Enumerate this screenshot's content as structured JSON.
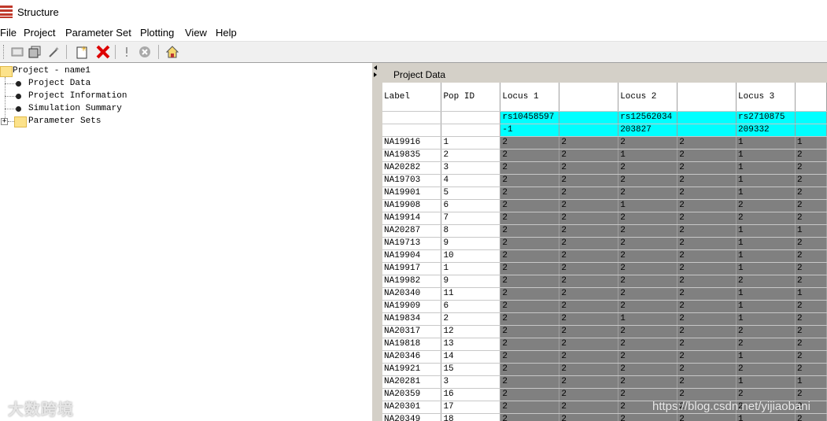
{
  "window": {
    "title": "Structure"
  },
  "menu": [
    "File",
    "Project",
    "Parameter Set",
    "Plotting",
    "View",
    "Help"
  ],
  "toolbar": {
    "icons": [
      "open-project-icon",
      "save-project-icon",
      "wizard-icon",
      "new-param-set-icon",
      "delete-icon",
      "warning-icon",
      "stop-icon",
      "home-icon"
    ]
  },
  "tree": {
    "root": "Project - name1",
    "children": [
      "Project Data",
      "Project Information",
      "Simulation Summary"
    ],
    "folder": "Parameter Sets"
  },
  "panel": {
    "title": "Project Data"
  },
  "grid": {
    "headers": [
      "Label",
      "Pop ID",
      "Locus 1",
      "",
      "Locus 2",
      "",
      "Locus 3",
      ""
    ],
    "snp_row": [
      "",
      "",
      "rs10458597",
      "",
      "rs12562034",
      "",
      "rs2710875",
      ""
    ],
    "pos_row": [
      "",
      "",
      "-1",
      "",
      "203827",
      "",
      "209332",
      ""
    ],
    "rows": [
      [
        "NA19916",
        "1",
        "2",
        "2",
        "2",
        "2",
        "1",
        "1"
      ],
      [
        "NA19835",
        "2",
        "2",
        "2",
        "1",
        "2",
        "1",
        "2"
      ],
      [
        "NA20282",
        "3",
        "2",
        "2",
        "2",
        "2",
        "1",
        "2"
      ],
      [
        "NA19703",
        "4",
        "2",
        "2",
        "2",
        "2",
        "1",
        "2"
      ],
      [
        "NA19901",
        "5",
        "2",
        "2",
        "2",
        "2",
        "1",
        "2"
      ],
      [
        "NA19908",
        "6",
        "2",
        "2",
        "1",
        "2",
        "2",
        "2"
      ],
      [
        "NA19914",
        "7",
        "2",
        "2",
        "2",
        "2",
        "2",
        "2"
      ],
      [
        "NA20287",
        "8",
        "2",
        "2",
        "2",
        "2",
        "1",
        "1"
      ],
      [
        "NA19713",
        "9",
        "2",
        "2",
        "2",
        "2",
        "1",
        "2"
      ],
      [
        "NA19904",
        "10",
        "2",
        "2",
        "2",
        "2",
        "1",
        "2"
      ],
      [
        "NA19917",
        "1",
        "2",
        "2",
        "2",
        "2",
        "1",
        "2"
      ],
      [
        "NA19982",
        "9",
        "2",
        "2",
        "2",
        "2",
        "2",
        "2"
      ],
      [
        "NA20340",
        "11",
        "2",
        "2",
        "2",
        "2",
        "1",
        "1"
      ],
      [
        "NA19909",
        "6",
        "2",
        "2",
        "2",
        "2",
        "1",
        "2"
      ],
      [
        "NA19834",
        "2",
        "2",
        "2",
        "1",
        "2",
        "1",
        "2"
      ],
      [
        "NA20317",
        "12",
        "2",
        "2",
        "2",
        "2",
        "2",
        "2"
      ],
      [
        "NA19818",
        "13",
        "2",
        "2",
        "2",
        "2",
        "2",
        "2"
      ],
      [
        "NA20346",
        "14",
        "2",
        "2",
        "2",
        "2",
        "1",
        "2"
      ],
      [
        "NA19921",
        "15",
        "2",
        "2",
        "2",
        "2",
        "2",
        "2"
      ],
      [
        "NA20281",
        "3",
        "2",
        "2",
        "2",
        "2",
        "1",
        "1"
      ],
      [
        "NA20359",
        "16",
        "2",
        "2",
        "2",
        "2",
        "2",
        "2"
      ],
      [
        "NA20301",
        "17",
        "2",
        "2",
        "2",
        "2",
        "2",
        "2"
      ],
      [
        "NA20349",
        "18",
        "2",
        "2",
        "2",
        "2",
        "1",
        "2"
      ]
    ]
  },
  "watermarks": {
    "left": "大数跨境",
    "right": "https://blog.csdn.net/yijiaobani"
  },
  "colors": {
    "highlight": "#00ffff",
    "genotype_bg": "#808080",
    "accent": "#c0392b"
  }
}
